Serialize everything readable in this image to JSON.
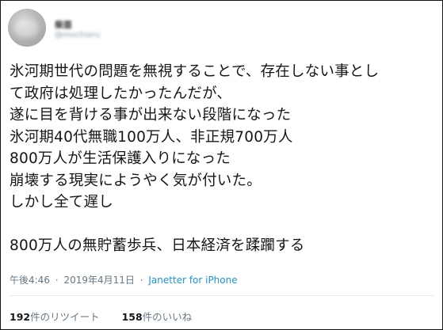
{
  "user": {
    "display_name": "柴亜",
    "handle": "@mochiaru"
  },
  "tweet": {
    "lines": [
      "氷河期世代の問題を無視することで、存在しない事とし",
      "て政府は処理したかったんだが、",
      "遂に目を背ける事が出来ない段階になった",
      "氷河期40代無職100万人、非正規700万人",
      "800万人が生活保護入りになった",
      "崩壊する現実にようやく気が付いた。",
      "しかし全て遅し",
      "",
      "800万人の無貯蓄歩兵、日本経済を蹂躙する"
    ]
  },
  "meta": {
    "time": "午後4:46",
    "separator1": "·",
    "date": "2019年4月11日",
    "separator2": "·",
    "source": "Janetter for iPhone"
  },
  "stats": {
    "retweets_count": "192",
    "retweets_label": "件のリツイート",
    "likes_count": "158",
    "likes_label": "件のいいね"
  },
  "colors": {
    "text": "#14171a",
    "muted": "#657786",
    "link": "#1b95e0",
    "divider": "#e6ecf0"
  }
}
